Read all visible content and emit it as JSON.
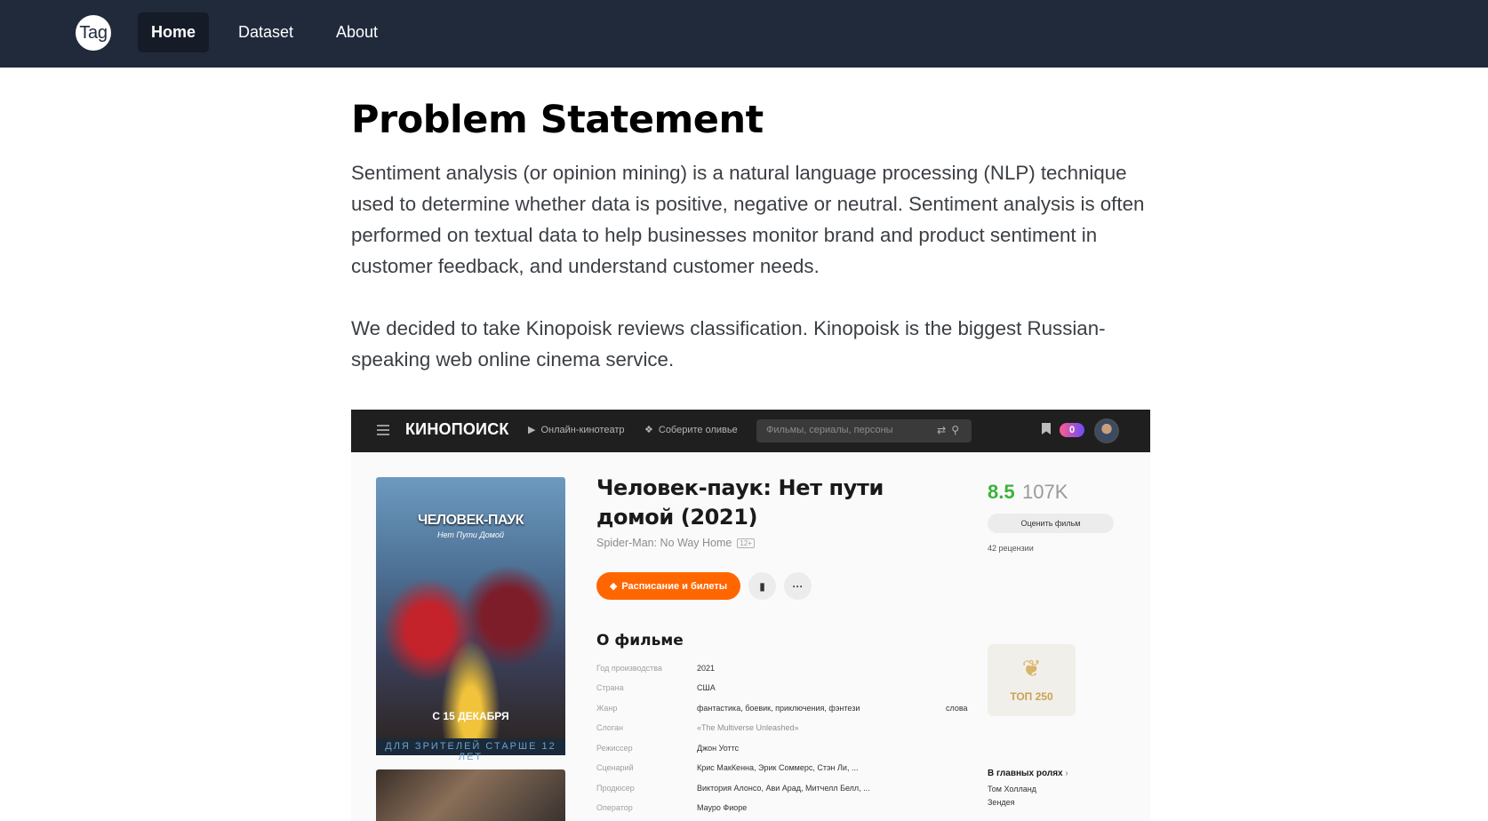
{
  "nav": {
    "brand": "Tag",
    "links": [
      "Home",
      "Dataset",
      "About"
    ],
    "active": "Home"
  },
  "main": {
    "title": "Problem Statement",
    "paragraphs": [
      "Sentiment analysis (or opinion mining) is a natural language processing (NLP) technique used to determine whether data is positive, negative or neutral. Sentiment analysis is often performed on textual data to help businesses monitor brand and product sentiment in customer feedback, and understand customer needs.",
      "We decided to take Kinopoisk reviews classification. Kinopoisk is the biggest Russian-speaking web online cinema service."
    ]
  },
  "screenshot": {
    "header": {
      "logo": "КИНОПОИСК",
      "menu_online": "Онлайн-кинотеатр",
      "menu_gift": "Соберите оливье",
      "search_placeholder": "Фильмы, сериалы, персоны",
      "plus_count": "0",
      "icons": [
        "menu-icon",
        "play-icon",
        "gift-icon",
        "filter-icon",
        "search-icon",
        "bookmark-icon",
        "plus-icon",
        "avatar"
      ]
    },
    "poster": {
      "title": "ЧЕЛОВЕК-ПАУК",
      "subtitle": "Нет Пути Домой",
      "date": "С 15 ДЕКАБРЯ",
      "strip": "ДЛЯ ЗРИТЕЛЕЙ СТАРШЕ 12 ЛЕТ"
    },
    "movie": {
      "title": "Человек-паук: Нет пути домой (2021)",
      "original_title": "Spider-Man: No Way Home",
      "age": "12+",
      "tickets_label": "Расписание и билеты",
      "more_label": "···"
    },
    "rating": {
      "score": "8.5",
      "votes": "107K",
      "rate_button": "Оценить фильм",
      "reviews": "42 рецензии"
    },
    "about": {
      "heading": "О фильме",
      "rows": [
        {
          "key": "Год производства",
          "value": "2021"
        },
        {
          "key": "Страна",
          "value": "США"
        },
        {
          "key": "Жанр",
          "value": "фантастика, боевик, приключения, фэнтези",
          "extra": "слова"
        },
        {
          "key": "Слоган",
          "value": "«The Multiverse Unleashed»"
        },
        {
          "key": "Режиссер",
          "value": "Джон Уоттс"
        },
        {
          "key": "Сценарий",
          "value": "Крис МакКенна, Эрик Соммерс, Стэн Ли, ..."
        },
        {
          "key": "Продюсер",
          "value": "Виктория Алонсо, Ави Арад, Митчелл Белл, ..."
        },
        {
          "key": "Оператор",
          "value": "Мауро Фиоре"
        }
      ]
    },
    "top250": {
      "label": "ТОП 250"
    },
    "cast": {
      "heading": "В главных ролях",
      "names": [
        "Том Холланд",
        "Зендея"
      ]
    }
  },
  "colors": {
    "navbar": "#212a3b",
    "active_link_bg": "#151b27",
    "kp_orange": "#ff6600",
    "kp_rating_green": "#3bb33b"
  }
}
